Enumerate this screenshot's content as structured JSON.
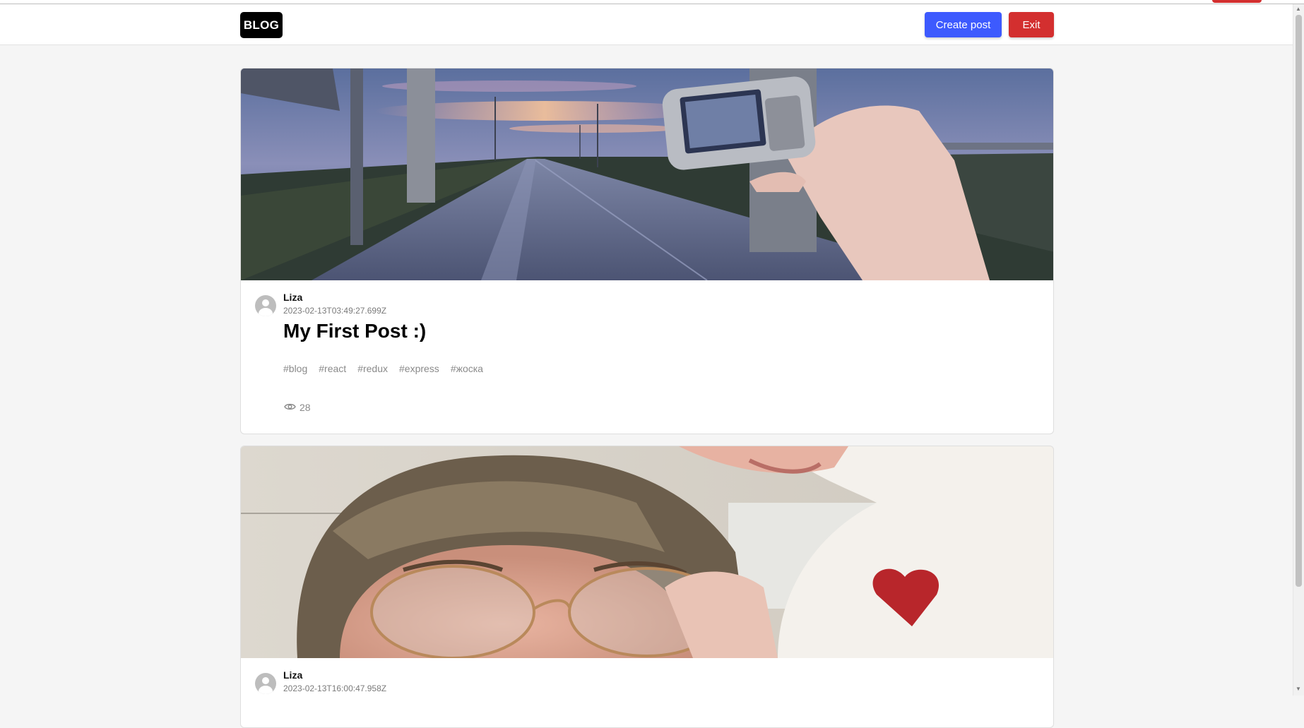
{
  "header": {
    "logo": "BLOG",
    "create_post_label": "Create post",
    "exit_label": "Exit"
  },
  "posts": [
    {
      "author": "Liza",
      "date": "2023-02-13T03:49:27.699Z",
      "title": "My First Post :)",
      "tags": [
        "#blog",
        "#react",
        "#redux",
        "#express",
        "#жоска"
      ],
      "views": "28",
      "image_description": "road-sunset-phone-photo"
    },
    {
      "author": "Liza",
      "date": "2023-02-13T16:00:47.958Z",
      "image_description": "selfie-glasses"
    }
  ],
  "colors": {
    "create_button": "#3d5afe",
    "exit_button": "#d32f2f",
    "logo_bg": "#000000",
    "page_bg": "#f5f5f5"
  },
  "icons": {
    "views": "eye-icon",
    "avatar": "user-avatar-icon"
  }
}
